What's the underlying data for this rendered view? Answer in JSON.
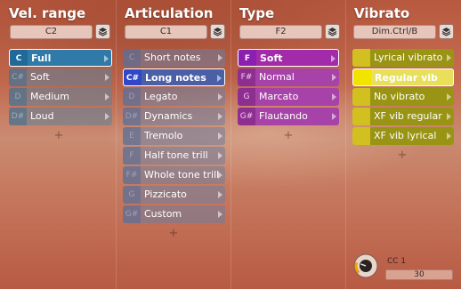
{
  "columns": [
    {
      "title": "Vel. range",
      "dropdown": "C2",
      "items": [
        {
          "key": "C",
          "label": "Full",
          "selected": true
        },
        {
          "key": "C#",
          "label": "Soft"
        },
        {
          "key": "D",
          "label": "Medium"
        },
        {
          "key": "D#",
          "label": "Loud"
        }
      ]
    },
    {
      "title": "Articulation",
      "dropdown": "C1",
      "items": [
        {
          "key": "C",
          "label": "Short notes"
        },
        {
          "key": "C#",
          "label": "Long notes",
          "selected": true
        },
        {
          "key": "D",
          "label": "Legato"
        },
        {
          "key": "D#",
          "label": "Dynamics"
        },
        {
          "key": "E",
          "label": "Tremolo"
        },
        {
          "key": "F",
          "label": "Half tone trill"
        },
        {
          "key": "F#",
          "label": "Whole tone trill"
        },
        {
          "key": "G",
          "label": "Pizzicato"
        },
        {
          "key": "G#",
          "label": "Custom"
        }
      ]
    },
    {
      "title": "Type",
      "dropdown": "F2",
      "items": [
        {
          "key": "F",
          "label": "Soft",
          "selected": true
        },
        {
          "key": "F#",
          "label": "Normal"
        },
        {
          "key": "G",
          "label": "Marcato"
        },
        {
          "key": "G#",
          "label": "Flautando"
        }
      ]
    },
    {
      "title": "Vibrato",
      "dropdown": "Dim.Ctrl/B",
      "items": [
        {
          "key": "",
          "label": "Lyrical vibrato"
        },
        {
          "key": "",
          "label": "Regular vib",
          "selected": true
        },
        {
          "key": "",
          "label": "No vibrato"
        },
        {
          "key": "",
          "label": "XF vib regular"
        },
        {
          "key": "",
          "label": "XF vib lyrical"
        }
      ]
    }
  ],
  "add_symbol": "+",
  "cc": {
    "label": "CC 1",
    "value": "30",
    "knob_fraction": 0.24
  },
  "icons": {
    "dropdown_extra": "stack-icon",
    "knob": "knob-icon"
  },
  "colors": {
    "vel_selected": "#2f7aa8",
    "articulation_selected": "#4b5fa6",
    "type_selected": "#a12ba8",
    "vibrato_selected": "#e8e05a",
    "vibrato_key": "#d2c020"
  }
}
